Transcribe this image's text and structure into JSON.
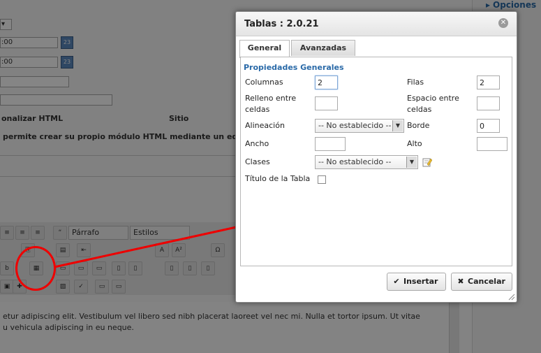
{
  "background": {
    "options_label": "Opciones",
    "time_value_1": ":00",
    "time_value_2": ":00",
    "col_header_1": "onalizar HTML",
    "col_header_2": "Sitio",
    "description": "permite crear su propio módulo HTML mediante un editor W",
    "format_select": "Párrafo",
    "styles_select": "Estilos",
    "editor_line_1": "etur adipiscing elit. Vestibulum vel libero sed nibh placerat laoreet vel nec mi. Nulla et tortor ipsum. Ut vitae",
    "editor_line_2": "u vehicula adipiscing in eu neque."
  },
  "dialog": {
    "title": "Tablas : 2.0.21",
    "tabs": [
      "General",
      "Avanzadas"
    ],
    "section_title": "Propiedades Generales",
    "fields": {
      "columns_label": "Columnas",
      "columns_value": "2",
      "rows_label": "Filas",
      "rows_value": "2",
      "padding_label_1": "Relleno entre",
      "padding_label_2": "celdas",
      "padding_value": "",
      "spacing_label_1": "Espacio entre",
      "spacing_label_2": "celdas",
      "spacing_value": "",
      "align_label": "Alineación",
      "align_value": "-- No establecido --",
      "border_label": "Borde",
      "border_value": "0",
      "width_label": "Ancho",
      "width_value": "",
      "height_label": "Alto",
      "height_value": "",
      "classes_label": "Clases",
      "classes_value": "-- No establecido --",
      "caption_label": "Título de la Tabla",
      "caption_checked": false
    },
    "buttons": {
      "insert": "Insertar",
      "cancel": "Cancelar"
    }
  },
  "colors": {
    "accent": "#2a6aa8",
    "annotation": "#e00000"
  }
}
